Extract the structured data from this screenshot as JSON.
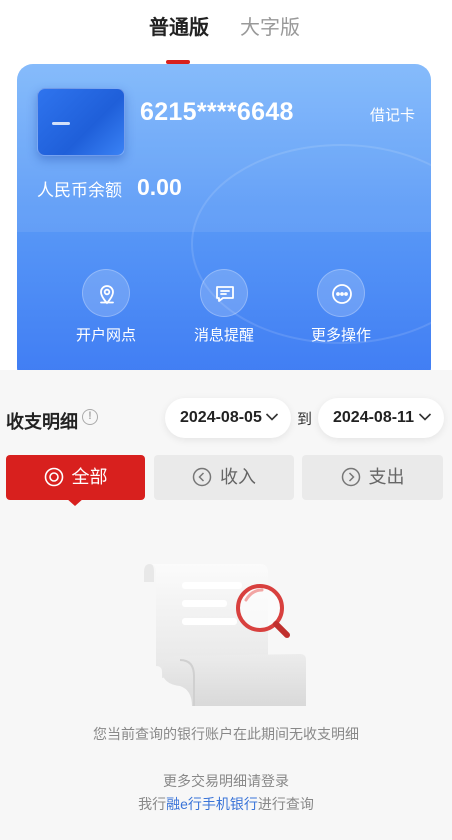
{
  "tabs": {
    "normal": "普通版",
    "large": "大字版"
  },
  "card": {
    "number": "6215****6648",
    "type": "借记卡",
    "balance_label": "人民币余额",
    "balance_value": "0.00",
    "actions": [
      {
        "label": "开户网点",
        "icon": "location-pin-icon"
      },
      {
        "label": "消息提醒",
        "icon": "message-icon"
      },
      {
        "label": "更多操作",
        "icon": "more-icon"
      }
    ]
  },
  "details": {
    "title": "收支明细",
    "date_from": "2024-08-05",
    "date_sep": "到",
    "date_to": "2024-08-11",
    "filters": {
      "all": "全部",
      "income": "收入",
      "expense": "支出"
    }
  },
  "empty": {
    "message": "您当前查询的银行账户在此期间无收支明细",
    "hint_line1": "更多交易明细请登录",
    "hint_prefix": "我行",
    "hint_link": "融e行手机银行",
    "hint_suffix": "进行查询"
  },
  "colors": {
    "accent": "#d8201e",
    "card_blue": "#4a8af5",
    "link": "#3a74d8"
  }
}
